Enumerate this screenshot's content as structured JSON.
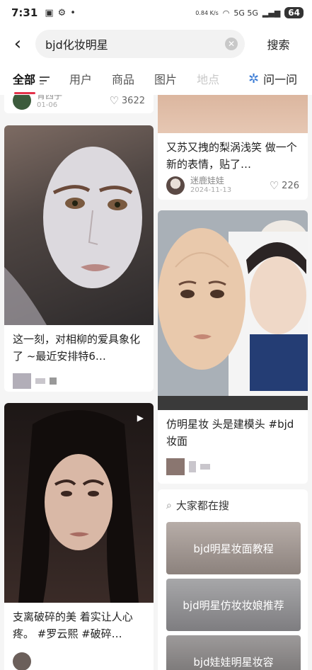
{
  "status": {
    "time": "7:31",
    "speed": "0.84\nK/s",
    "network": "5G 5G",
    "battery": "64"
  },
  "search": {
    "value": "bjd化妆明星",
    "button": "搜索"
  },
  "tabs": [
    {
      "label": "全部"
    },
    {
      "label": "用户"
    },
    {
      "label": "商品"
    },
    {
      "label": "图片"
    },
    {
      "label": "地点"
    }
  ],
  "ask": {
    "label": "问一问"
  },
  "left_col": {
    "top_stub": {
      "author": "青西子",
      "date": "01-06",
      "likes": "3622"
    },
    "card1": {
      "title": "这一刻，对相柳的爱具象化了 ~最近安排特6…"
    },
    "card2": {
      "title": "支离破碎的美 着实让人心疼。 #罗云熙 #破碎…"
    }
  },
  "right_col": {
    "card0": {
      "title": "又苏又拽的梨涡浅笑 做一个新的表情，贴了…",
      "author": "迷鹿娃娃",
      "date": "2024-11-13",
      "likes": "226"
    },
    "card1": {
      "title": "仿明星妆 头是建模头 #bjd妆面"
    },
    "trending": {
      "header": "大家都在搜",
      "items": [
        {
          "label": "bjd明星妆面教程"
        },
        {
          "label": "bjd明星仿妆妆娘推荐"
        },
        {
          "label": "bjd娃娃明星妆容"
        }
      ]
    }
  },
  "colors": {
    "accent": "#e4324a",
    "ask_icon": "#3a7bd5"
  }
}
